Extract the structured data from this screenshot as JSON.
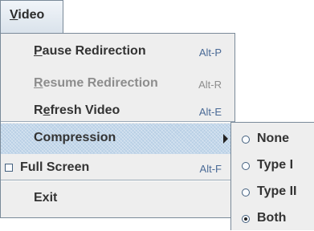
{
  "menubar": {
    "video": {
      "pre": "",
      "mnemonic": "V",
      "post": "ideo"
    }
  },
  "menu": {
    "items": [
      {
        "pre": "",
        "mnemonic": "P",
        "post": "ause Redirection",
        "accel": "Alt-P",
        "enabled": true
      },
      {
        "pre": "",
        "mnemonic": "R",
        "post": "esume Redirection",
        "accel": "Alt-R",
        "enabled": false
      },
      {
        "pre": "R",
        "mnemonic": "e",
        "post": "fresh Video",
        "accel": "Alt-E",
        "enabled": true
      },
      {
        "label": "Compression",
        "has_submenu": true,
        "selected": true
      },
      {
        "label": "Full Screen",
        "accel": "Alt-F",
        "checkbox": true,
        "checked": false
      },
      {
        "label": "Exit"
      }
    ]
  },
  "compression_submenu": {
    "options": [
      {
        "label": "None",
        "checked": false
      },
      {
        "label": "Type I",
        "checked": false
      },
      {
        "label": "Type II",
        "checked": false
      },
      {
        "label": "Both",
        "checked": true
      }
    ]
  },
  "colors": {
    "highlight": "#b8cfe5",
    "menu_bg": "#eeeeee",
    "accel_text": "#4a6a96",
    "disabled_text": "#8d8d8d",
    "border": "#7a8a99"
  }
}
